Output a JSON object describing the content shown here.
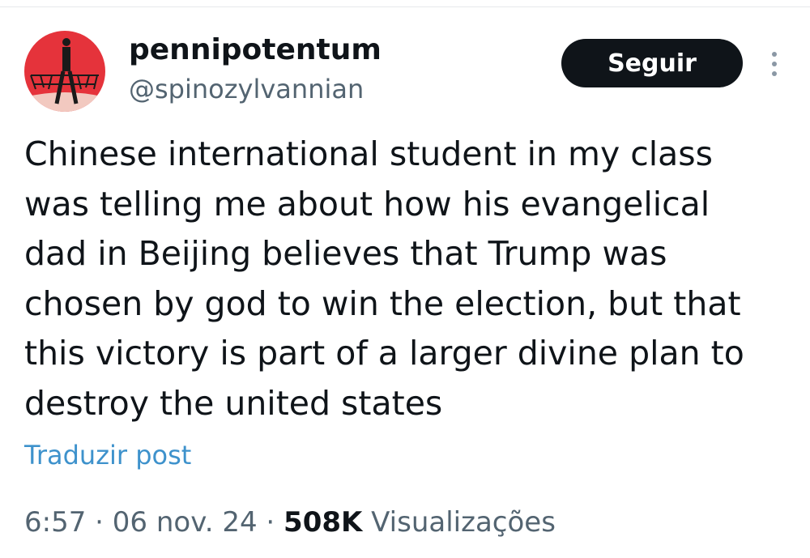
{
  "user": {
    "display_name": "pennipotentum",
    "handle": "@spinozylvannian",
    "avatar_icon": "avatar-illustration"
  },
  "header": {
    "follow_label": "Seguir",
    "more_icon": "more-vertical-icon"
  },
  "tweet": {
    "text": "Chinese international student in my class\nwas telling me about how his evangelical\ndad in Beijing believes that Trump was\nchosen by god to win the election, but that\nthis victory is part of a larger divine plan to\ndestroy the united states",
    "translate_label": "Traduzir post"
  },
  "meta": {
    "time": "6:57",
    "separator": " · ",
    "date": "06 nov. 24",
    "views_count": "508K",
    "views_label": "Visualizações"
  },
  "colors": {
    "text": "#0f1419",
    "secondary": "#536471",
    "link": "#3e92cc",
    "button_bg": "#0f1419",
    "avatar_bg": "#e5333b"
  }
}
